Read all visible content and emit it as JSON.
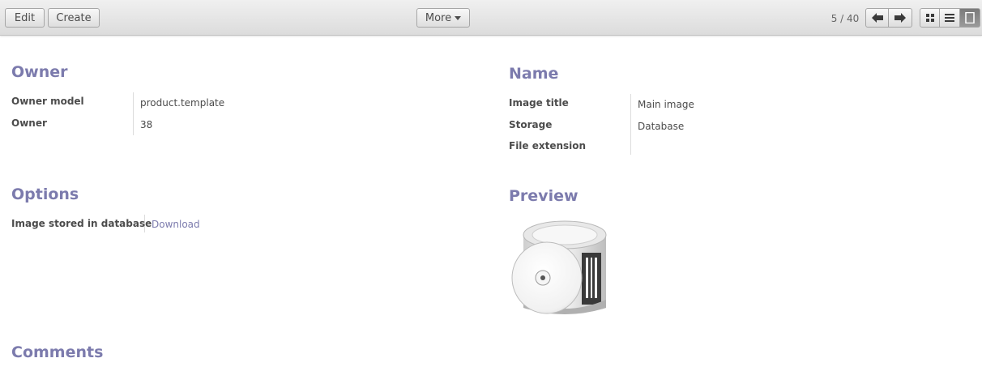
{
  "toolbar": {
    "edit_label": "Edit",
    "create_label": "Create",
    "more_label": "More",
    "pager_text": "5 / 40",
    "icons": [
      "arrow-left-icon",
      "arrow-right-icon",
      "kanban-view-icon",
      "list-view-icon",
      "form-view-icon"
    ]
  },
  "owner_section": {
    "title": "Owner",
    "fields": [
      {
        "label": "Owner model",
        "value": "product.template"
      },
      {
        "label": "Owner",
        "value": "38"
      }
    ]
  },
  "name_section": {
    "title": "Name",
    "fields": [
      {
        "label": "Image title",
        "value": "Main image"
      },
      {
        "label": "Storage",
        "value": "Database"
      },
      {
        "label": "File extension",
        "value": ""
      }
    ]
  },
  "options_section": {
    "title": "Options",
    "fields": [
      {
        "label": "Image stored in database",
        "value": "Download"
      }
    ]
  },
  "preview_section": {
    "title": "Preview",
    "image": "cd-spindle-image"
  },
  "comments_section": {
    "title": "Comments"
  },
  "colors": {
    "section_title": "#7c7bad",
    "link": "#7c7bad",
    "text": "#4c4c4c"
  }
}
